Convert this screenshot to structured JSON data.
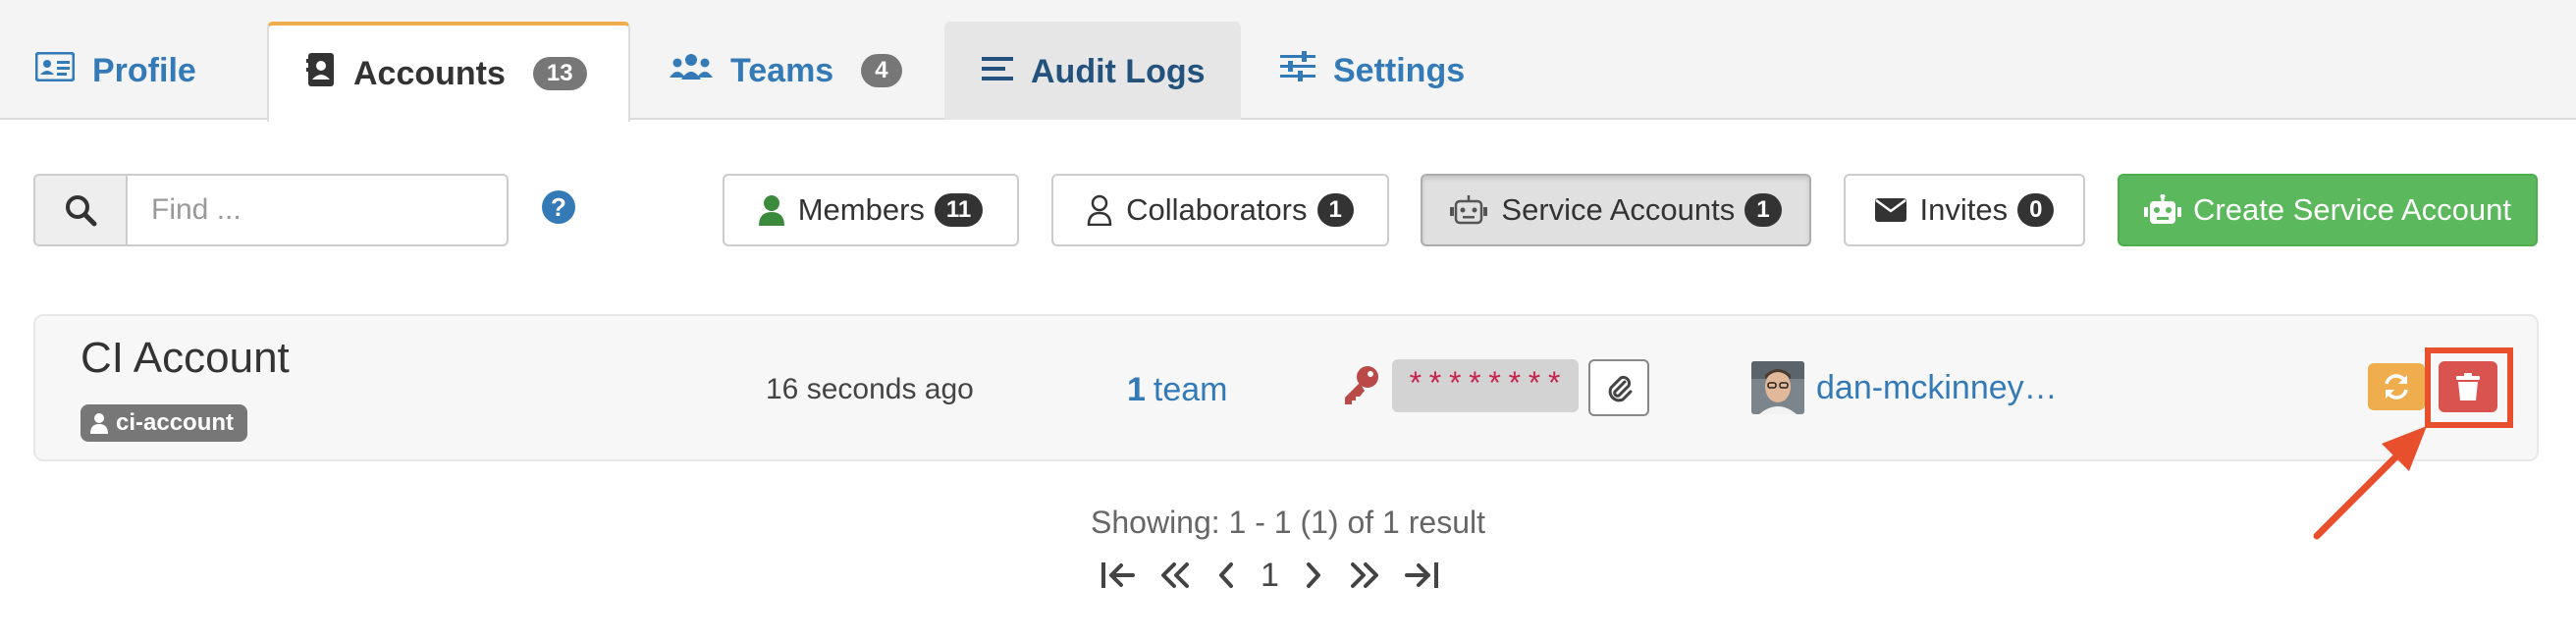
{
  "tabs": [
    {
      "label": "Profile",
      "icon": "id-card-icon"
    },
    {
      "label": "Accounts",
      "icon": "address-book-icon",
      "badge": "13"
    },
    {
      "label": "Teams",
      "icon": "users-icon",
      "badge": "4"
    },
    {
      "label": "Audit Logs",
      "icon": "list-icon"
    },
    {
      "label": "Settings",
      "icon": "sliders-icon"
    }
  ],
  "search": {
    "placeholder": "Find ...",
    "value": ""
  },
  "filters": [
    {
      "label": "Members",
      "count": "11",
      "icon": "user-icon"
    },
    {
      "label": "Collaborators",
      "count": "1",
      "icon": "user-outline-icon"
    },
    {
      "label": "Service Accounts",
      "count": "1",
      "icon": "robot-icon"
    },
    {
      "label": "Invites",
      "count": "0",
      "icon": "envelope-icon"
    }
  ],
  "create_button": {
    "label": "Create Service Account",
    "icon": "robot-icon"
  },
  "account": {
    "name": "CI Account",
    "username": "ci-account",
    "created": "16 seconds ago",
    "team_count": "1",
    "team_label": "team",
    "token_mask": "********",
    "owner": "dan-mckinney…"
  },
  "pagination": {
    "showing": "Showing: 1 - 1 (1) of 1 result",
    "current_page": "1"
  },
  "colors": {
    "link": "#337ab7",
    "active_tab_accent": "#f0ad4e",
    "create": "#5cb85c",
    "delete": "#d9534f",
    "refresh": "#f0ad4e",
    "annotation": "#e8502d"
  }
}
